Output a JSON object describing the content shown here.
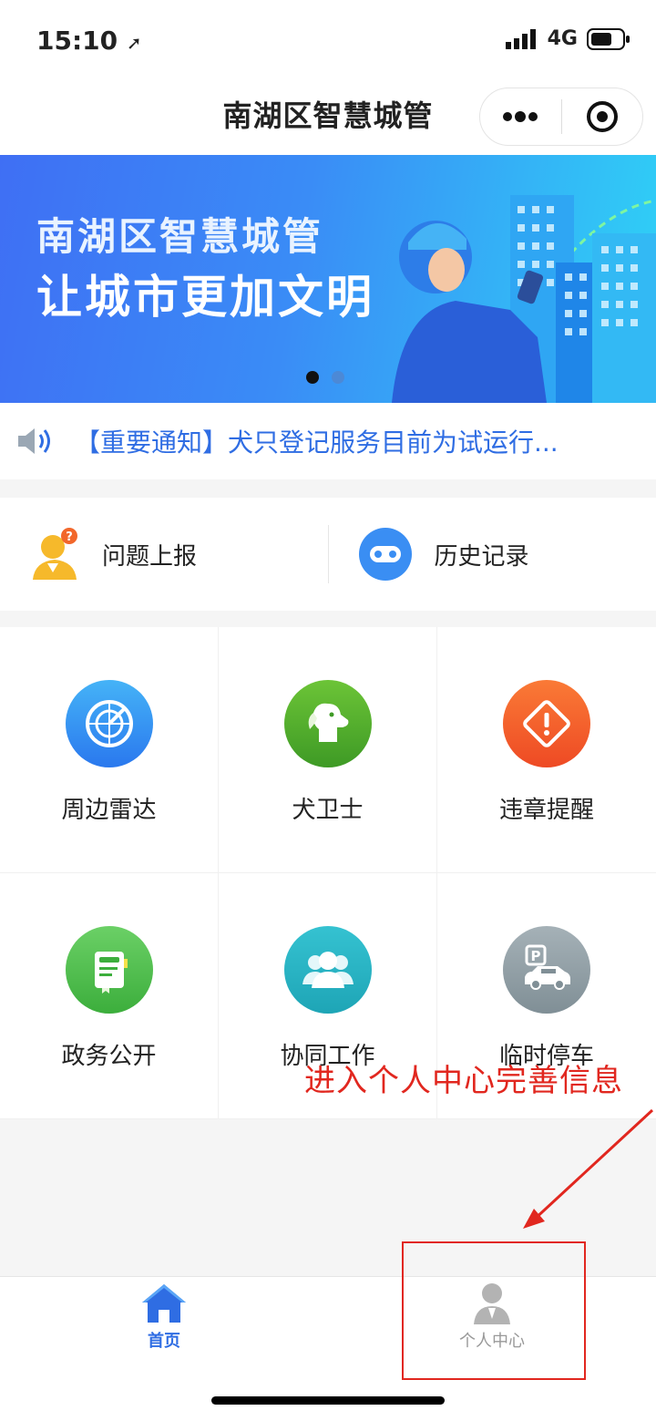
{
  "status_bar": {
    "time": "15:10",
    "network": "4G"
  },
  "nav": {
    "title": "南湖区智慧城管"
  },
  "banner": {
    "line1": "南湖区智慧城管",
    "line2": "让城市更加文明",
    "slide_count": 2,
    "active_slide": 1
  },
  "notice": {
    "text": "【重要通知】犬只登记服务目前为试运行..."
  },
  "quick_actions": [
    {
      "label": "问题上报",
      "icon": "report-person-icon"
    },
    {
      "label": "历史记录",
      "icon": "history-icon"
    }
  ],
  "services": [
    {
      "label": "周边雷达",
      "icon": "radar-icon",
      "color": "#2b8ff2"
    },
    {
      "label": "犬卫士",
      "icon": "dog-icon",
      "color": "#4cae2c"
    },
    {
      "label": "违章提醒",
      "icon": "warning-icon",
      "color": "#f2592c"
    },
    {
      "label": "政务公开",
      "icon": "document-icon",
      "color": "#4cbc4a"
    },
    {
      "label": "协同工作",
      "icon": "group-icon",
      "color": "#22b3c4"
    },
    {
      "label": "临时停车",
      "icon": "parking-car-icon",
      "color": "#8e9ca3"
    }
  ],
  "tabbar": {
    "items": [
      {
        "label": "首页",
        "icon": "home-icon",
        "active": true
      },
      {
        "label": "个人中心",
        "icon": "user-icon",
        "active": false
      }
    ],
    "active_color": "#2f6de3",
    "inactive_color": "#999999"
  },
  "annotation": {
    "text": "进入个人中心完善信息",
    "color": "#e1271f"
  }
}
